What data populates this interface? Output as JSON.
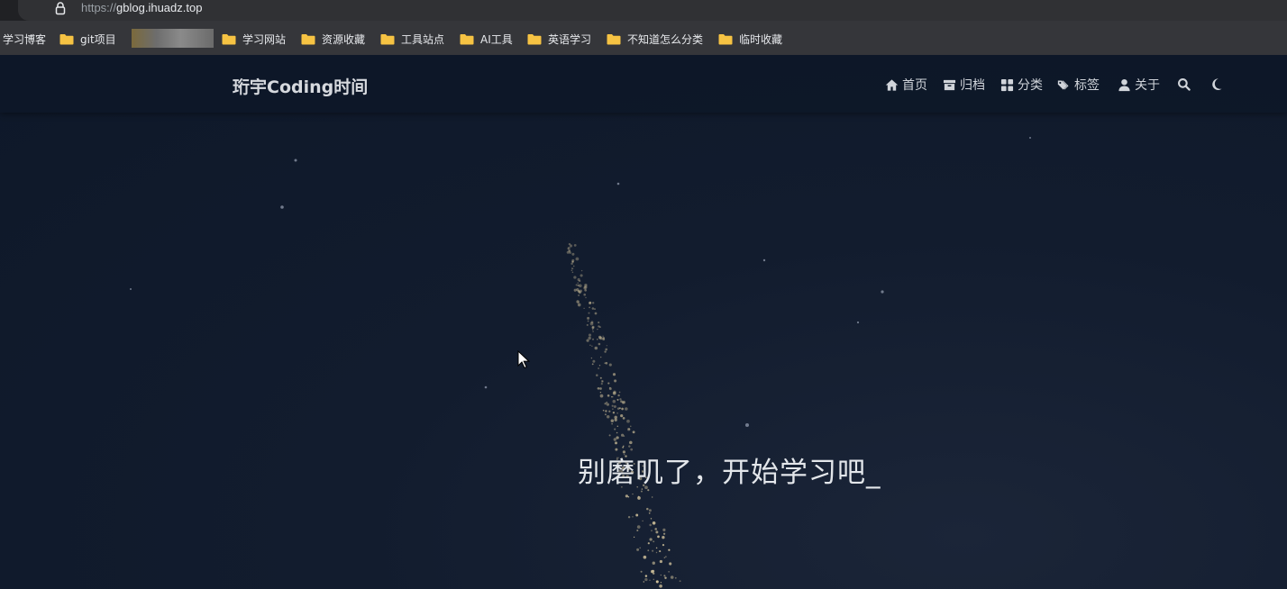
{
  "browser": {
    "url_protocol": "https://",
    "url_host": "gblog.ihuadz.top"
  },
  "bookmarks": [
    {
      "label": "学习博客",
      "icon": "none"
    },
    {
      "label": "git项目",
      "icon": "folder-icon"
    },
    {
      "label": "学习网站",
      "icon": "folder-icon"
    },
    {
      "label": "资源收藏",
      "icon": "folder-icon"
    },
    {
      "label": "工具站点",
      "icon": "folder-icon"
    },
    {
      "label": "AI工具",
      "icon": "folder-icon"
    },
    {
      "label": "英语学习",
      "icon": "folder-icon"
    },
    {
      "label": "不知道怎么分类",
      "icon": "folder-icon"
    },
    {
      "label": "临时收藏",
      "icon": "folder-icon"
    }
  ],
  "site": {
    "title": "珩宇Coding时间",
    "nav": [
      {
        "label": "首页",
        "icon": "home-icon"
      },
      {
        "label": "归档",
        "icon": "archive-icon"
      },
      {
        "label": "分类",
        "icon": "grid-icon"
      },
      {
        "label": "标签",
        "icon": "tags-icon"
      },
      {
        "label": "关于",
        "icon": "user-icon"
      }
    ],
    "search_icon": "search-icon",
    "theme_icon": "moon-icon",
    "slogan": "别磨叽了，开始学习吧_"
  },
  "colors": {
    "background": "#0f1a2c",
    "header": "#0d1728",
    "folder": "#f6c343",
    "sparkle": "#d9c9a0"
  }
}
